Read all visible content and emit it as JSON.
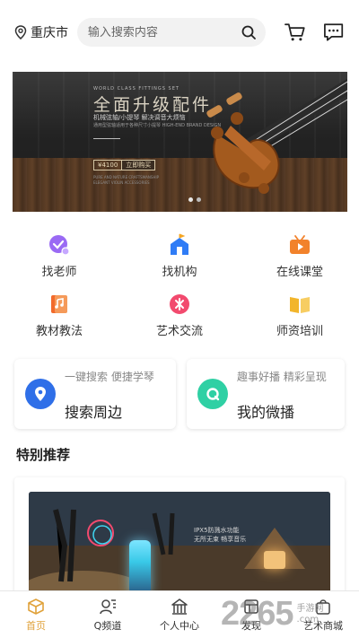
{
  "header": {
    "city": "重庆市",
    "search_placeholder": "输入搜索内容"
  },
  "banner": {
    "small_top": "WORLD CLASS FITTINGS SET",
    "title": "全面升级配件",
    "sub1": "机械弦轴/小提琴 解决调音大烦恼",
    "sub2": "通用型弦轴适用于各种尺寸小提琴 HIGH-END BRAND DESIGN",
    "price": "¥4100",
    "buy": "立即购买",
    "foot": "PURE AND NATURE CRAFTSMANSHIP ELEGANT VIOLIN ACCESSORIES"
  },
  "quick": [
    {
      "label": "找老师",
      "icon": "teacher-icon",
      "color": "#8f5cf0"
    },
    {
      "label": "找机构",
      "icon": "institution-icon",
      "color": "#2f7cf6"
    },
    {
      "label": "在线课堂",
      "icon": "online-class-icon",
      "color": "#f2822b"
    },
    {
      "label": "教材教法",
      "icon": "textbook-icon",
      "color": "#f26a2b"
    },
    {
      "label": "艺术交流",
      "icon": "art-exchange-icon",
      "color": "#f24a6e"
    },
    {
      "label": "师资培训",
      "icon": "teacher-training-icon",
      "color": "#f2b52b"
    }
  ],
  "cards": [
    {
      "small": "一键搜索 便捷学琴",
      "big": "搜索周边",
      "icon": "location-pin-icon",
      "color": "#2f6fe8"
    },
    {
      "small": "趣事好播 精彩呈现",
      "big": "我的微播",
      "icon": "microlive-icon",
      "color": "#2fd0a4"
    }
  ],
  "section_title": "特别推荐",
  "recommend": {
    "text1": "IPX5防溅水功能",
    "text2": "无所无束 畅享音乐"
  },
  "tabs": [
    {
      "label": "首页",
      "icon": "home-icon",
      "active": true
    },
    {
      "label": "Q频道",
      "icon": "channel-icon",
      "active": false
    },
    {
      "label": "个人中心",
      "icon": "profile-icon",
      "active": false
    },
    {
      "label": "发现",
      "icon": "discover-icon",
      "active": false
    },
    {
      "label": "艺术商城",
      "icon": "mall-icon",
      "active": false
    }
  ],
  "watermark": {
    "num": "2265",
    "side1": "手游网",
    "side2": ".com"
  }
}
